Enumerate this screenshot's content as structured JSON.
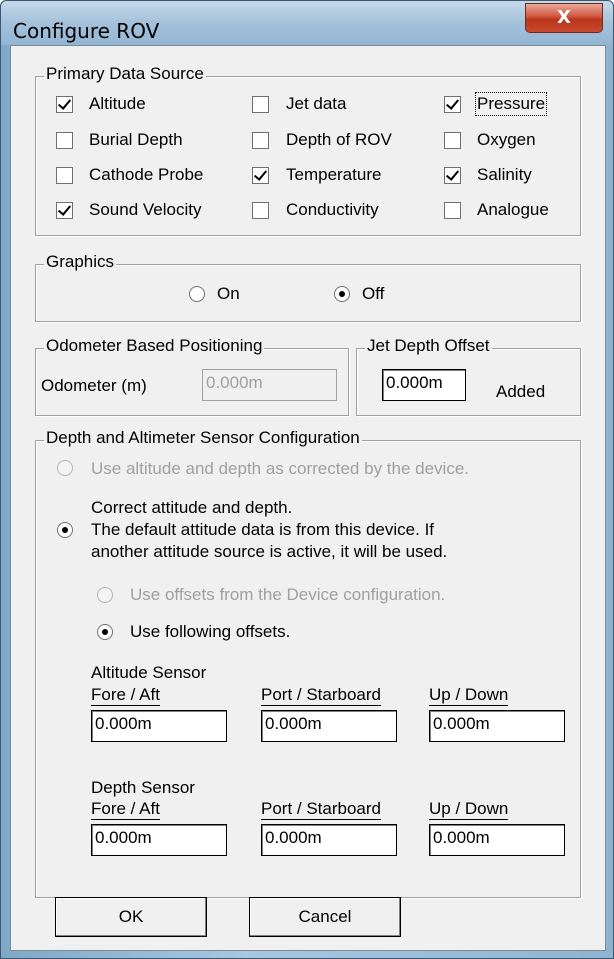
{
  "window": {
    "title": "Configure ROV",
    "close_glyph": "X"
  },
  "primary_data_source": {
    "legend": "Primary Data Source",
    "items": [
      {
        "label": "Altitude",
        "checked": true
      },
      {
        "label": "Jet data",
        "checked": false
      },
      {
        "label": "Pressure",
        "checked": true
      },
      {
        "label": "Burial Depth",
        "checked": false
      },
      {
        "label": "Depth of ROV",
        "checked": false
      },
      {
        "label": "Oxygen",
        "checked": false
      },
      {
        "label": "Cathode Probe",
        "checked": false
      },
      {
        "label": "Temperature",
        "checked": true
      },
      {
        "label": "Salinity",
        "checked": true
      },
      {
        "label": "Sound Velocity",
        "checked": true
      },
      {
        "label": "Conductivity",
        "checked": false
      },
      {
        "label": "Analogue",
        "checked": false
      }
    ]
  },
  "graphics": {
    "legend": "Graphics",
    "on_label": "On",
    "off_label": "Off",
    "selected": "Off"
  },
  "odometer": {
    "legend": "Odometer Based Positioning",
    "label": "Odometer (m)",
    "value": "0.000m"
  },
  "jet_depth_offset": {
    "legend": "Jet Depth Offset",
    "value": "0.000m",
    "suffix": "Added"
  },
  "sensor_config": {
    "legend": "Depth and Altimeter Sensor Configuration",
    "option_device": "Use altitude and depth as corrected by the device.",
    "option_correct_line1": "Correct attitude and depth.",
    "option_correct_line2": "The default attitude data is from this device. If",
    "option_correct_line3": "another attitude source is active, it will be used.",
    "sub_option_device": "Use offsets from the Device configuration.",
    "sub_option_following": "Use following offsets.",
    "altitude_sensor": {
      "heading": "Altitude Sensor",
      "fore_aft_label": "Fore / Aft",
      "port_starboard_label": "Port / Starboard",
      "up_down_label": "Up / Down",
      "fore_aft": "0.000m",
      "port_starboard": "0.000m",
      "up_down": "0.000m"
    },
    "depth_sensor": {
      "heading": "Depth Sensor",
      "fore_aft_label": "Fore / Aft",
      "port_starboard_label": "Port / Starboard",
      "up_down_label": "Up / Down",
      "fore_aft": "0.000m",
      "port_starboard": "0.000m",
      "up_down": "0.000m"
    }
  },
  "buttons": {
    "ok": "OK",
    "cancel": "Cancel"
  }
}
